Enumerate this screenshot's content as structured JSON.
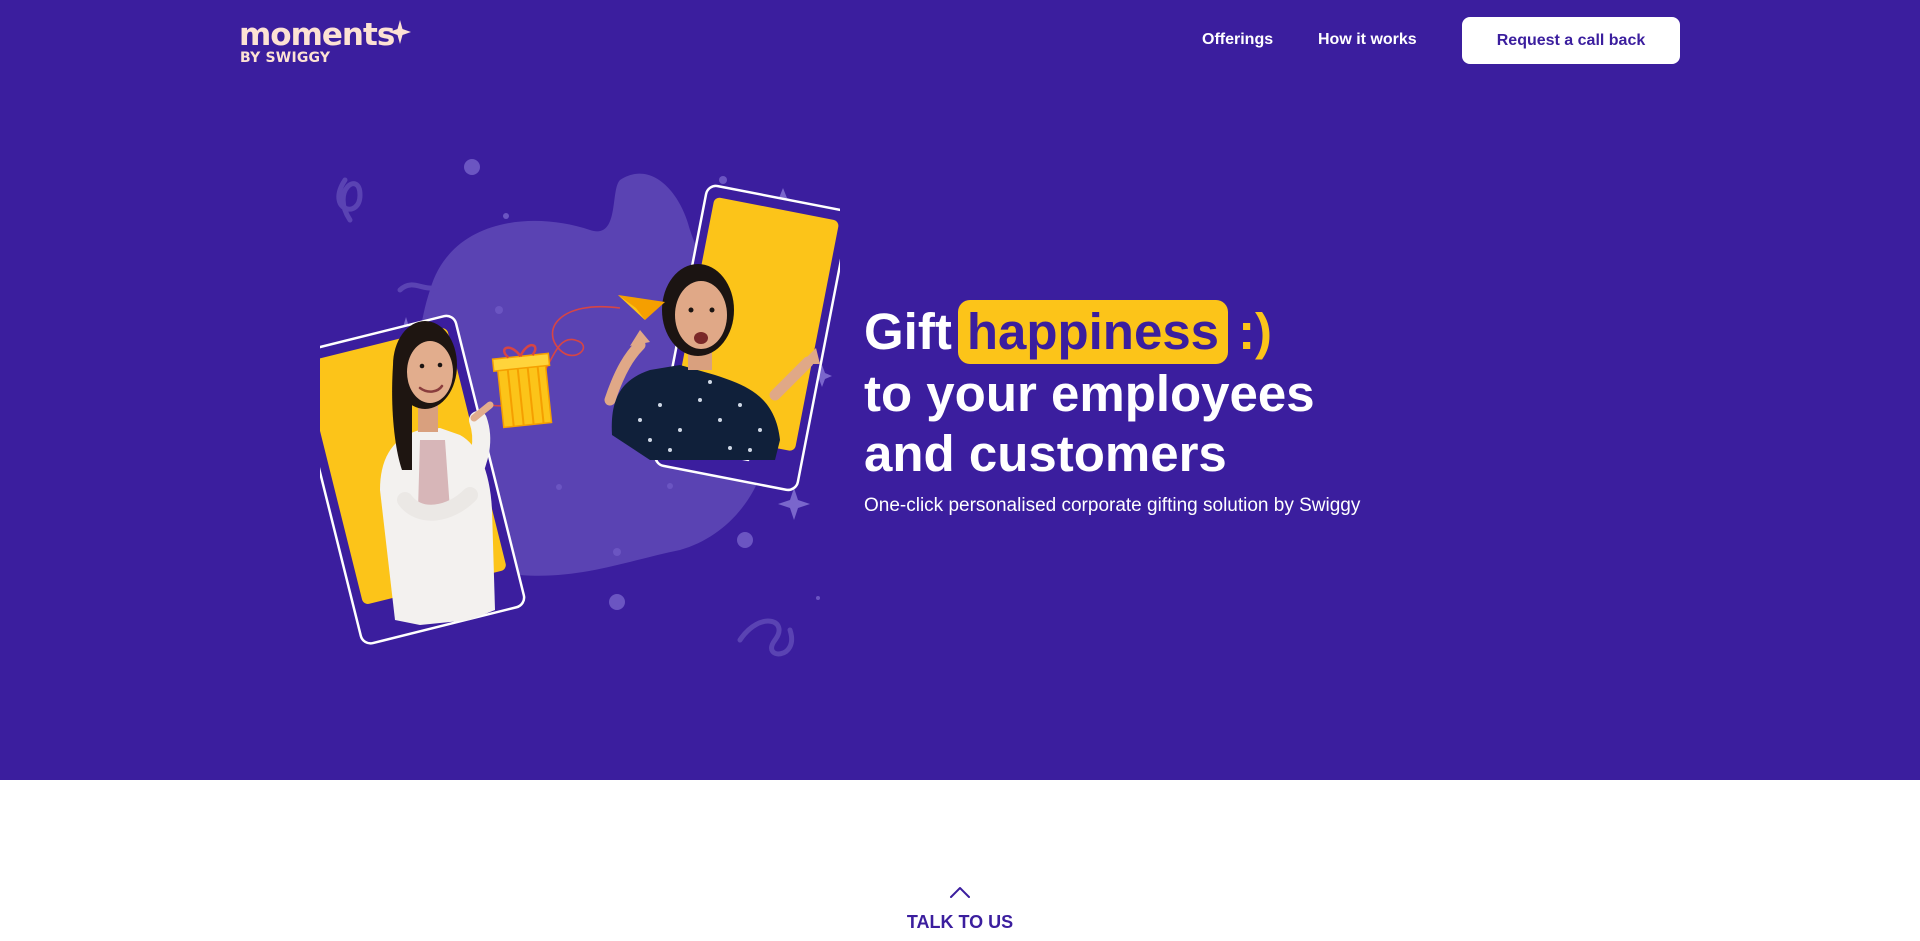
{
  "header": {
    "logo_main": "moments",
    "logo_sub": "BY SWIGGY",
    "nav": [
      {
        "label": "Offerings"
      },
      {
        "label": "How it works"
      }
    ],
    "cta_label": "Request a call back"
  },
  "hero": {
    "headline_word1": "Gift",
    "headline_highlight": "happiness",
    "headline_smiley": ":)",
    "headline_line2": "to your employees",
    "headline_line3": "and customers",
    "tagline": "One-click personalised corporate gifting solution by Swiggy"
  },
  "talk": {
    "label": "TALK TO US",
    "icon": "chevron-up-icon"
  },
  "colors": {
    "brand_purple": "#3b1e9e",
    "accent_yellow": "#fcc419",
    "logo_peach": "#fde2d4",
    "white": "#ffffff"
  }
}
